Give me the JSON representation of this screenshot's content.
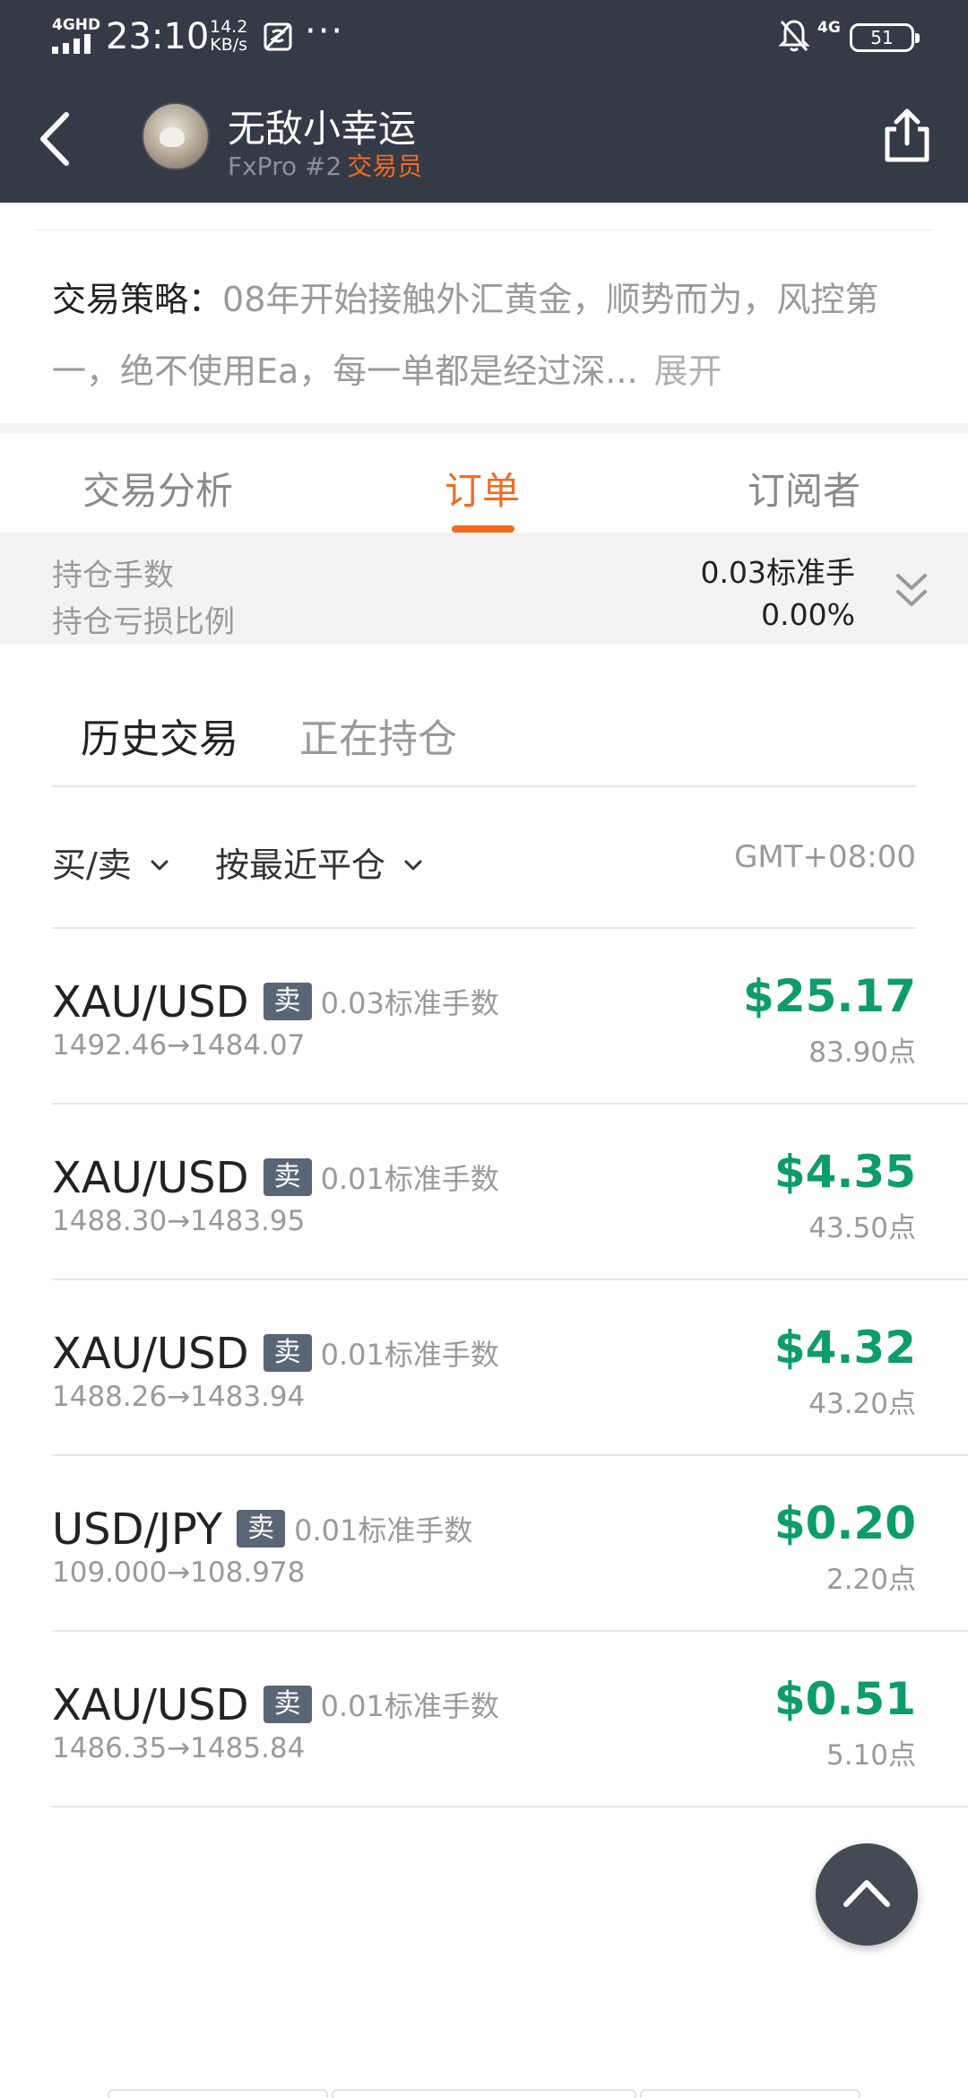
{
  "status_bar": {
    "network_type": "4GHD",
    "time": "23:10",
    "speed_value": "14.2",
    "speed_unit": "KB/s",
    "more": "···",
    "network_right": "4G",
    "battery": "51",
    "icons": [
      "signal-icon",
      "screen-record-icon",
      "bell-off-icon",
      "battery-icon"
    ]
  },
  "header": {
    "trader_name": "无敌小幸运",
    "broker": "FxPro #2",
    "role": "交易员",
    "icons": [
      "back-arrow-icon",
      "share-icon"
    ],
    "accent_color": "#f26b21",
    "background_color": "#343b46"
  },
  "strategy": {
    "label": "交易策略：",
    "text": "08年开始接触外汇黄金，顺势而为，风控第一，绝不使用Ea，每一单都是经过深...",
    "expand": "展开"
  },
  "tabs": [
    {
      "label": "交易分析",
      "active": false
    },
    {
      "label": "订单",
      "active": true
    },
    {
      "label": "订阅者",
      "active": false
    }
  ],
  "summary": {
    "position_label": "持仓手数",
    "position_value": "0.03标准手",
    "loss_label": "持仓亏损比例",
    "loss_value": "0.00%",
    "toggle_icon": "double-chevron-down-icon"
  },
  "subtabs": {
    "history": "历史交易",
    "open": "正在持仓"
  },
  "filters": {
    "side": "买/卖",
    "sort": "按最近平仓",
    "timezone": "GMT+08:00"
  },
  "trades": [
    {
      "symbol": "XAU/USD",
      "side": "卖",
      "lots": "0.03标准手数",
      "prices": "1492.46→1484.07",
      "profit": "$25.17",
      "points": "83.90点"
    },
    {
      "symbol": "XAU/USD",
      "side": "卖",
      "lots": "0.01标准手数",
      "prices": "1488.30→1483.95",
      "profit": "$4.35",
      "points": "43.50点"
    },
    {
      "symbol": "XAU/USD",
      "side": "卖",
      "lots": "0.01标准手数",
      "prices": "1488.26→1483.94",
      "profit": "$4.32",
      "points": "43.20点"
    },
    {
      "symbol": "USD/JPY",
      "side": "卖",
      "lots": "0.01标准手数",
      "prices": "109.000→108.978",
      "profit": "$0.20",
      "points": "2.20点"
    },
    {
      "symbol": "XAU/USD",
      "side": "卖",
      "lots": "0.01标准手数",
      "prices": "1486.35→1485.84",
      "profit": "$0.51",
      "points": "5.10点"
    }
  ],
  "profit_color": "#0e9c6a",
  "scroll_top_icon": "chevron-up-icon"
}
